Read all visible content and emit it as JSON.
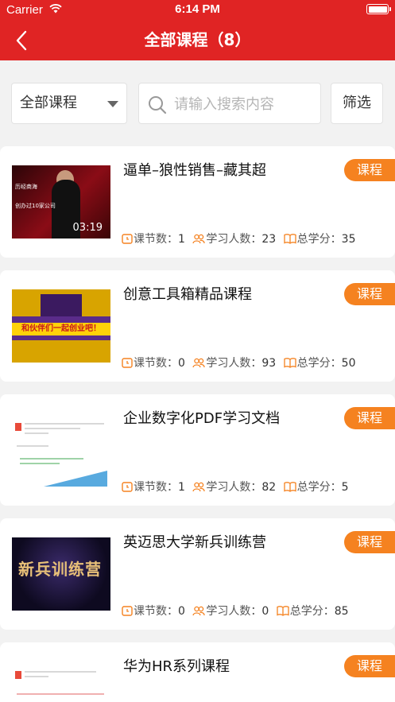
{
  "status_bar": {
    "carrier": "Carrier",
    "time": "6:14 PM"
  },
  "nav": {
    "title": "全部课程（8）"
  },
  "filter": {
    "category": "全部课程",
    "search_placeholder": "请输入搜索内容",
    "filter_label": "筛选"
  },
  "labels": {
    "lessons": "课节数：",
    "learners": "学习人数：",
    "credits": "总学分："
  },
  "courses": [
    {
      "title": "逼单–狼性销售–藏其超",
      "tag": "课程",
      "lessons": "1",
      "learners": "23",
      "credits": "35",
      "duration": "03:19"
    },
    {
      "title": "创意工具箱精品课程",
      "tag": "课程",
      "lessons": "0",
      "learners": "93",
      "credits": "50",
      "banner": "和伙伴们一起创业吧！"
    },
    {
      "title": "企业数字化PDF学习文档",
      "tag": "课程",
      "lessons": "1",
      "learners": "82",
      "credits": "5"
    },
    {
      "title": "英迈思大学新兵训练营",
      "tag": "课程",
      "lessons": "0",
      "learners": "0",
      "credits": "85",
      "banner": "新兵训练营"
    },
    {
      "title": "华为HR系列课程",
      "tag": "课程"
    }
  ],
  "colors": {
    "brand": "#e02424",
    "tag": "#f58220"
  }
}
